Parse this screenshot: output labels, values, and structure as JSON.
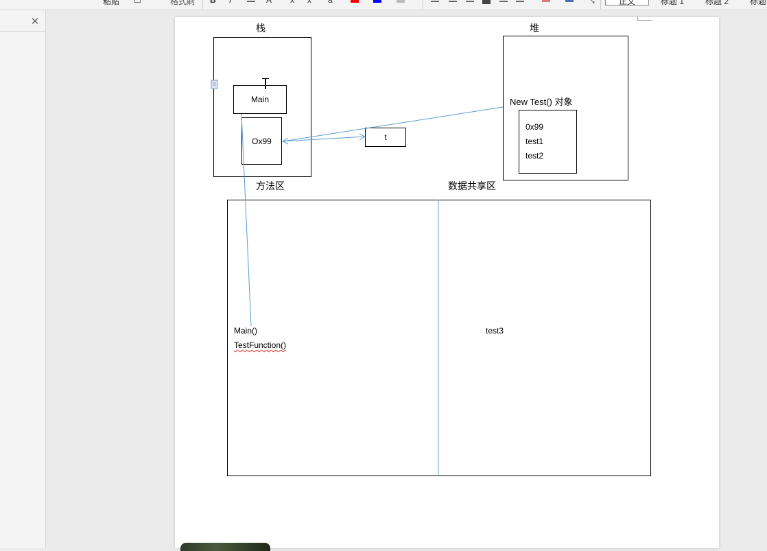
{
  "toolbar": {
    "paste_label": "粘贴",
    "format_painter_label": "格式刷",
    "bold_label": "B",
    "italic_label": "I",
    "style_normal": "正文",
    "style_heading1": "标题 1",
    "style_heading2": "标题 2",
    "style_heading3": "标题",
    "colors": {
      "font_red": "#ff0000",
      "font_blue": "#0000ff"
    }
  },
  "side_panel": {
    "close_icon": "close-icon"
  },
  "diagram": {
    "stack_title": "栈",
    "heap_title": "堆",
    "main_box": "Main",
    "ref_box": "Ox99",
    "t_box": "t",
    "heap_object_label": "New Test()  对象",
    "heap_fields": [
      "0x99",
      "test1",
      "test2"
    ],
    "method_area_title": "方法区",
    "shared_area_title": "数据共享区",
    "method_items": [
      "Main()",
      "TestFunction()"
    ],
    "shared_items": [
      "test3"
    ],
    "connector_color": "#5b9bd5"
  }
}
